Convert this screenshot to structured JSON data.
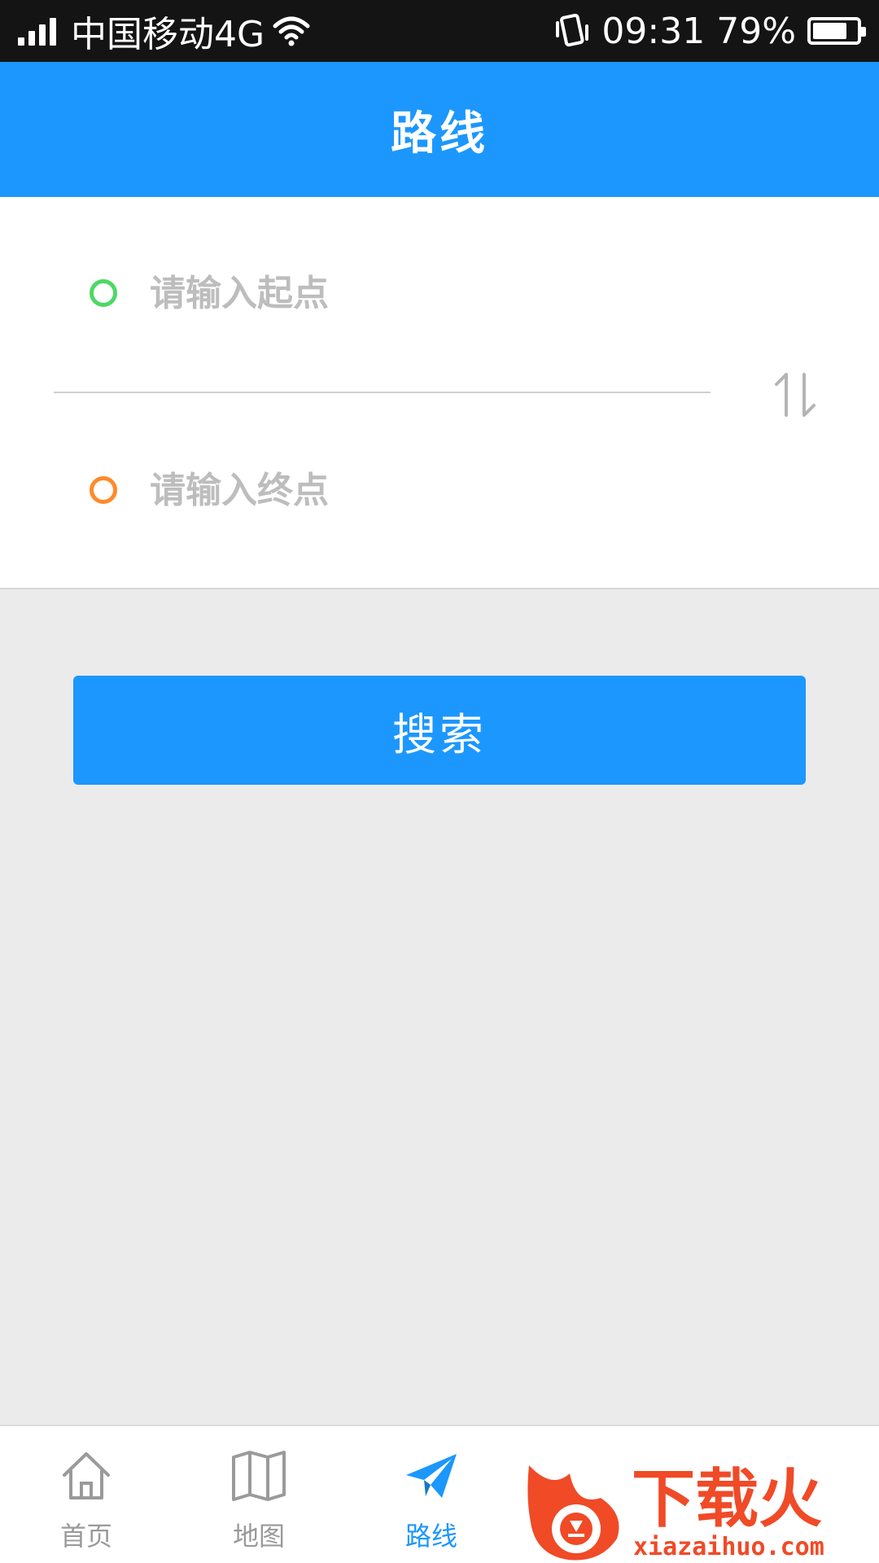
{
  "status_bar": {
    "carrier": "中国移动4G",
    "time": "09:31",
    "battery_percent": "79%",
    "battery_level": 0.79
  },
  "header": {
    "title": "路线"
  },
  "route": {
    "start_placeholder": "请输入起点",
    "end_placeholder": "请输入终点",
    "start_value": "",
    "end_value": ""
  },
  "search": {
    "label": "搜索"
  },
  "nav": {
    "items": [
      {
        "label": "首页",
        "icon": "home-icon"
      },
      {
        "label": "地图",
        "icon": "map-icon"
      },
      {
        "label": "路线",
        "icon": "paper-plane-icon",
        "active": true
      }
    ]
  },
  "watermark": {
    "text": "下载火",
    "domain": "xiazaihuo.com"
  },
  "colors": {
    "primary": "#1c97fd",
    "start_ring": "#4cd964",
    "end_ring": "#ff8a2a",
    "watermark": "#f04a27"
  }
}
